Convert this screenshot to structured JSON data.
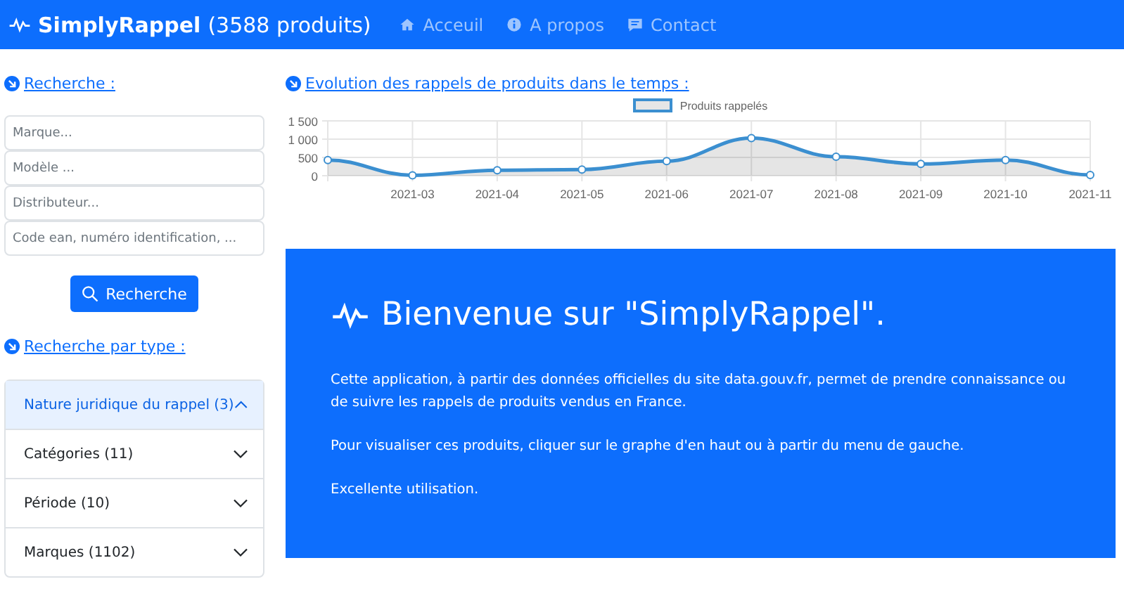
{
  "navbar": {
    "brand": "SimplyRappel",
    "count": "(3588 produits)",
    "links": [
      {
        "label": "Acceuil"
      },
      {
        "label": "A propos"
      },
      {
        "label": "Contact"
      }
    ]
  },
  "search": {
    "heading": "Recherche :",
    "fields": [
      {
        "placeholder": "Marque..."
      },
      {
        "placeholder": "Modèle ..."
      },
      {
        "placeholder": "Distributeur..."
      },
      {
        "placeholder": "Code ean, numéro identification, ..."
      }
    ],
    "button": "Recherche"
  },
  "type_search": {
    "heading": "Recherche par type :",
    "items": [
      {
        "label": "Nature juridique du rappel (3)",
        "expanded": true
      },
      {
        "label": "Catégories (11)",
        "expanded": false
      },
      {
        "label": "Période (10)",
        "expanded": false
      },
      {
        "label": "Marques (1102)",
        "expanded": false
      }
    ]
  },
  "chart_section": {
    "heading": "Evolution des rappels de produits dans le temps :",
    "chart_data": {
      "type": "area",
      "grid": true,
      "categories": [
        null,
        "2021-03",
        "2021-04",
        "2021-05",
        "2021-06",
        "2021-07",
        "2021-08",
        "2021-09",
        "2021-10",
        "2021-11"
      ],
      "series": [
        {
          "name": "Produits rappelés",
          "color": "#3b8fd0",
          "values": [
            430,
            10,
            150,
            170,
            400,
            1030,
            520,
            320,
            430,
            20
          ]
        }
      ],
      "ylim": [
        0,
        1500
      ],
      "yticks": [
        {
          "value": 0,
          "label": "0"
        },
        {
          "value": 500,
          "label": "500"
        },
        {
          "value": 1000,
          "label": "1 000"
        },
        {
          "value": 1500,
          "label": "1 500"
        }
      ]
    }
  },
  "welcome": {
    "title": "Bienvenue sur \"SimplyRappel\".",
    "paragraphs": [
      "Cette application, à partir des données officielles du site data.gouv.fr, permet de prendre connaissance ou de suivre les rappels de produits vendus en France.",
      "Pour visualiser ces produits, cliquer sur le graphe d'en haut ou à partir du menu de gauche.",
      "Excellente utilisation."
    ]
  }
}
